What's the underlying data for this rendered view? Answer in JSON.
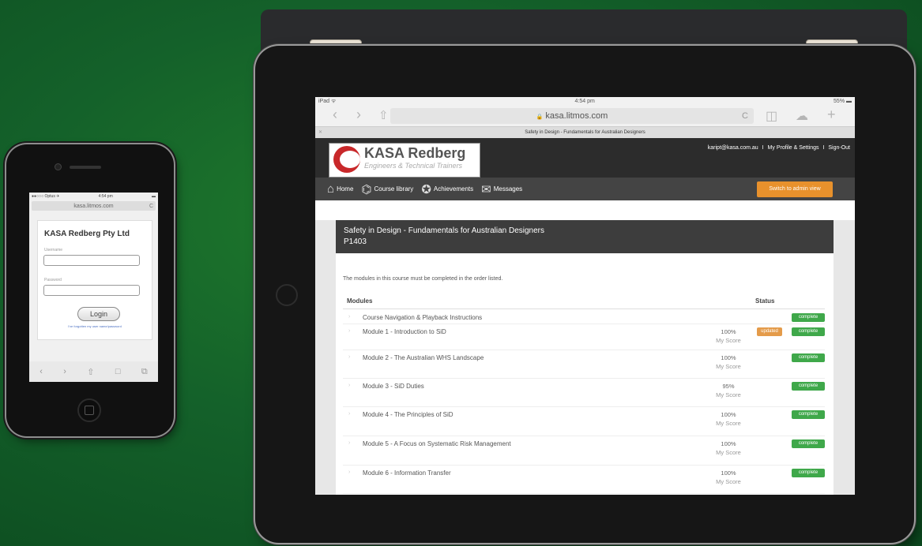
{
  "phone": {
    "status_carrier": "●●○○○ Optus ✈",
    "status_time": "4:54 pm",
    "status_battery": "▬",
    "url": "kasa.litmos.com",
    "reload": "C",
    "title": "KASA Redberg Pty Ltd",
    "username_label": "Username",
    "password_label": "Password",
    "login_label": "Login",
    "forgot_text": "I've forgotten my user name/password",
    "toolbar": [
      "‹",
      "›",
      "⇧",
      "□",
      "⧉"
    ]
  },
  "ipad": {
    "status_left": "iPad ᯤ",
    "status_time": "4:54 pm",
    "status_right": "55% ▬",
    "nav_back": "‹",
    "nav_forward": "›",
    "nav_share": "⇧",
    "lock": "🔒",
    "url": "kasa.litmos.com",
    "reload": "C",
    "nav_bookmarks": "◫",
    "nav_cloud": "☁",
    "nav_add": "+",
    "tab_close": "✕",
    "tab_title": "Safety in Design - Fundamentals for Australian Designers",
    "logo_name": "KASA Redberg",
    "logo_tagline": "Engineers & Technical Trainers",
    "user_email": "kaript@kasa.com.au",
    "profile_link": "My Profile & Settings",
    "signout_link": "Sign-Out",
    "sep": "I",
    "menu": [
      {
        "icon": "⌂",
        "label": "Home"
      },
      {
        "icon": "⌬",
        "label": "Course library"
      },
      {
        "icon": "✪",
        "label": "Achievements"
      },
      {
        "icon": "✉",
        "label": "Messages"
      }
    ],
    "admin_button": "Switch to admin view",
    "course_title": "Safety in Design - Fundamentals for Australian Designers",
    "course_code": "P1403",
    "order_note": "The modules in this course must be completed in the order listed.",
    "modules_header": "Modules",
    "status_header": "Status",
    "score_label": "My Score",
    "complete_label": "complete",
    "updated_label": "updated",
    "modules": [
      {
        "name": "Course Navigation & Playback Instructions",
        "score": "",
        "updated": false
      },
      {
        "name": "Module 1 - Introduction to SiD",
        "score": "100%",
        "updated": true
      },
      {
        "name": "Module 2 - The Australian WHS Landscape",
        "score": "100%",
        "updated": false
      },
      {
        "name": "Module 3 - SiD Duties",
        "score": "95%",
        "updated": false
      },
      {
        "name": "Module 4 - The Principles of SiD",
        "score": "100%",
        "updated": false
      },
      {
        "name": "Module 5 - A Focus on Systematic Risk Management",
        "score": "100%",
        "updated": false
      },
      {
        "name": "Module 6 - Information Transfer",
        "score": "100%",
        "updated": false
      }
    ]
  }
}
